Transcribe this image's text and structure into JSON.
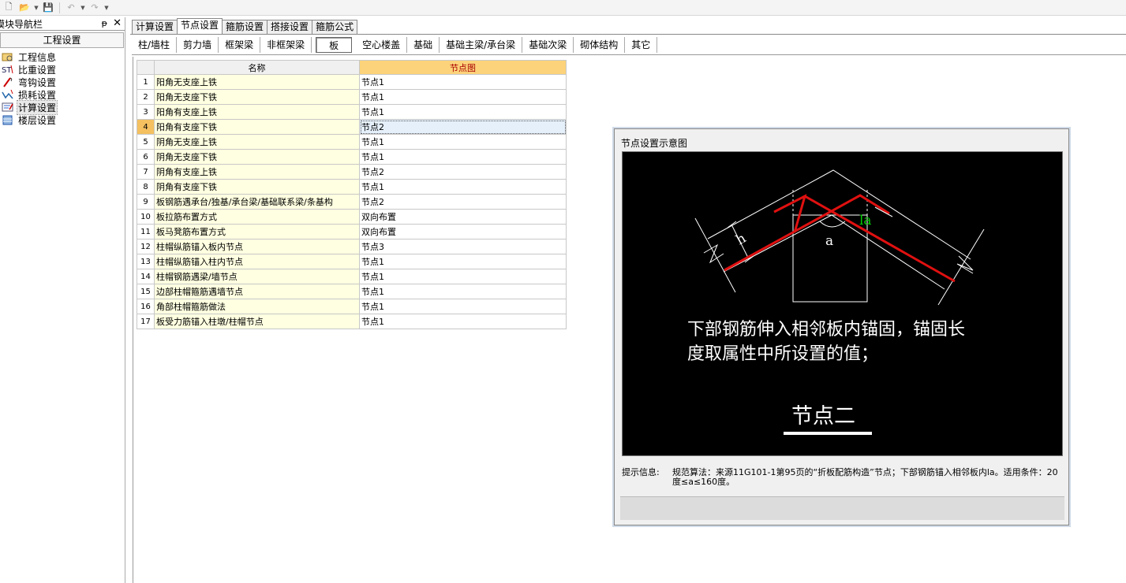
{
  "nav": {
    "title": "模块导航栏",
    "pin": "ᵽ",
    "close": "✕",
    "header": "工程设置",
    "items": [
      {
        "label": "工程信息",
        "icon": "info-icon"
      },
      {
        "label": "比重设置",
        "icon": "weight-icon"
      },
      {
        "label": "弯钩设置",
        "icon": "hook-icon"
      },
      {
        "label": "损耗设置",
        "icon": "loss-icon"
      },
      {
        "label": "计算设置",
        "icon": "calc-icon"
      },
      {
        "label": "楼层设置",
        "icon": "floor-icon"
      }
    ]
  },
  "tabs": [
    "计算设置",
    "节点设置",
    "箍筋设置",
    "搭接设置",
    "箍筋公式"
  ],
  "subtabs": [
    "柱/墙柱",
    "剪力墙",
    "框架梁",
    "非框架梁",
    "板",
    "空心楼盖",
    "基础",
    "基础主梁/承台梁",
    "基础次梁",
    "砌体结构",
    "其它"
  ],
  "table": {
    "headers": [
      "名称",
      "节点图"
    ],
    "rows": [
      {
        "n": "1",
        "name": "阳角无支座上铁",
        "val": "节点1"
      },
      {
        "n": "2",
        "name": "阳角无支座下铁",
        "val": "节点1"
      },
      {
        "n": "3",
        "name": "阳角有支座上铁",
        "val": "节点1"
      },
      {
        "n": "4",
        "name": "阳角有支座下铁",
        "val": "节点2"
      },
      {
        "n": "5",
        "name": "阴角无支座上铁",
        "val": "节点1"
      },
      {
        "n": "6",
        "name": "阴角无支座下铁",
        "val": "节点1"
      },
      {
        "n": "7",
        "name": "阴角有支座上铁",
        "val": "节点2"
      },
      {
        "n": "8",
        "name": "阴角有支座下铁",
        "val": "节点1"
      },
      {
        "n": "9",
        "name": "板钢筋遇承台/独基/承台梁/基础联系梁/条基构",
        "val": "节点2"
      },
      {
        "n": "10",
        "name": "板拉筋布置方式",
        "val": "双向布置"
      },
      {
        "n": "11",
        "name": "板马凳筋布置方式",
        "val": "双向布置"
      },
      {
        "n": "12",
        "name": "柱帽纵筋锚入板内节点",
        "val": "节点3"
      },
      {
        "n": "13",
        "name": "柱帽纵筋锚入柱内节点",
        "val": "节点1"
      },
      {
        "n": "14",
        "name": "柱帽钢筋遇梁/墙节点",
        "val": "节点1"
      },
      {
        "n": "15",
        "name": "边部柱帽箍筋遇墙节点",
        "val": "节点1"
      },
      {
        "n": "16",
        "name": "角部柱帽箍筋做法",
        "val": "节点1"
      },
      {
        "n": "17",
        "name": "板受力筋锚入柱墩/柱帽节点",
        "val": "节点1"
      }
    ]
  },
  "dialog": {
    "title": "节点设置示意图",
    "diagram": {
      "label_h": "h",
      "label_la": "la",
      "label_a": "a",
      "desc_line1": "下部钢筋伸入相邻板内锚固，锚固长",
      "desc_line2": "度取属性中所设置的值；",
      "node_title": "节点二"
    },
    "hint_label": "提示信息:",
    "hint_text": "规范算法：来源11G101-1第95页的“折板配筋构造”节点；下部钢筋锚入相邻板内la。适用条件：20度≤a≤160度。"
  },
  "colors": {
    "rebar": "#e01010",
    "la_label": "#00cc00",
    "canvas_bg": "#000000",
    "header_highlight": "#fcd37a"
  }
}
